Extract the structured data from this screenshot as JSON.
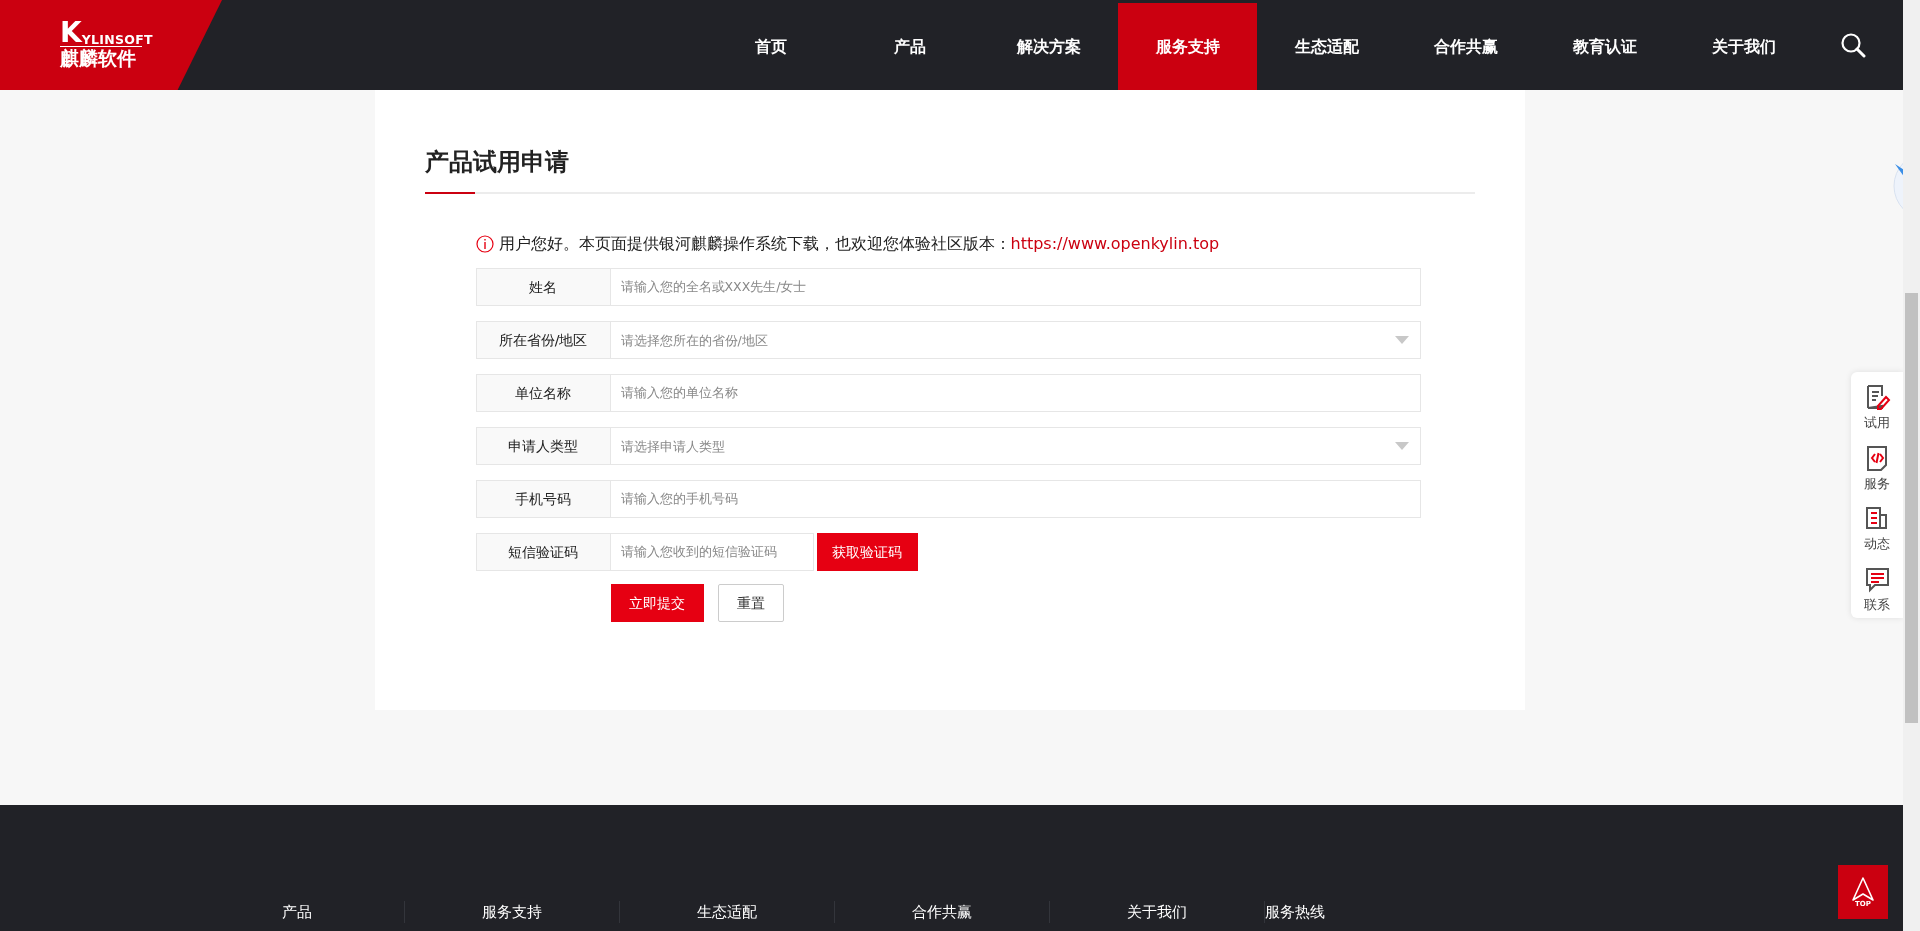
{
  "header": {
    "logo_latin": "YLINSOFT",
    "logo_initial": "K",
    "logo_chinese": "麒麟软件",
    "nav": [
      {
        "label": "首页",
        "selected": false
      },
      {
        "label": "产品",
        "selected": false
      },
      {
        "label": "解决方案",
        "selected": false
      },
      {
        "label": "服务支持",
        "selected": true
      },
      {
        "label": "生态适配",
        "selected": false
      },
      {
        "label": "合作共赢",
        "selected": false
      },
      {
        "label": "教育认证",
        "selected": false
      },
      {
        "label": "关于我们",
        "selected": false
      }
    ]
  },
  "form": {
    "title": "产品试用申请",
    "notice": "用户您好。本页面提供银河麒麟操作系统下载，也欢迎您体验社区版本：",
    "notice_link": "https://www.openkylin.top",
    "fields": [
      {
        "kind": "text",
        "label": "姓名",
        "placeholder": "请输入您的全名或XXX先生/女士"
      },
      {
        "kind": "select",
        "label": "所在省份/地区",
        "placeholder": "请选择您所在的省份/地区"
      },
      {
        "kind": "text",
        "label": "单位名称",
        "placeholder": "请输入您的单位名称"
      },
      {
        "kind": "select",
        "label": "申请人类型",
        "placeholder": "请选择申请人类型"
      },
      {
        "kind": "text",
        "label": "手机号码",
        "placeholder": "请输入您的手机号码"
      },
      {
        "kind": "code",
        "label": "短信验证码",
        "placeholder": "请输入您收到的短信验证码",
        "button": "获取验证码"
      }
    ],
    "buttons": [
      {
        "kind": "primary",
        "label": "立即提交"
      },
      {
        "kind": "outline",
        "label": "重置"
      }
    ]
  },
  "side_menu": [
    {
      "kind": "trial",
      "label": "试用"
    },
    {
      "kind": "service",
      "label": "服务"
    },
    {
      "kind": "news",
      "label": "动态"
    },
    {
      "kind": "contact",
      "label": "联系"
    }
  ],
  "back_to_top": "TOP",
  "footer": {
    "columns": [
      "产品",
      "服务支持",
      "生态适配",
      "合作共赢",
      "关于我们",
      "服务热线"
    ]
  }
}
